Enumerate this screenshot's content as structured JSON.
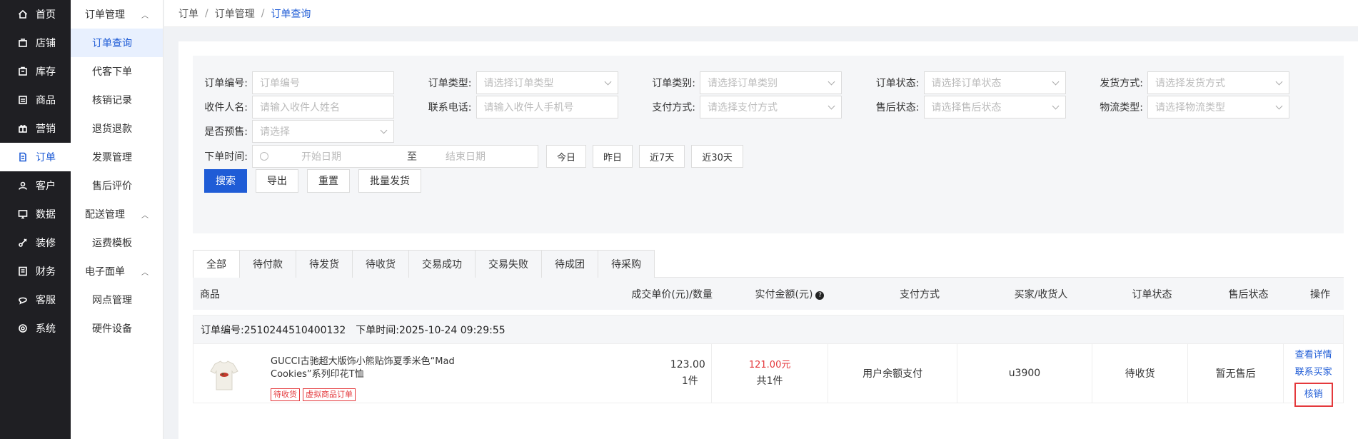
{
  "nav": {
    "items": [
      {
        "label": "首页",
        "icon": "home-icon"
      },
      {
        "label": "店铺",
        "icon": "shop-icon"
      },
      {
        "label": "库存",
        "icon": "inventory-icon"
      },
      {
        "label": "商品",
        "icon": "goods-icon"
      },
      {
        "label": "营销",
        "icon": "gift-icon"
      },
      {
        "label": "订单",
        "icon": "order-icon",
        "active": true
      },
      {
        "label": "客户",
        "icon": "user-icon"
      },
      {
        "label": "数据",
        "icon": "data-icon"
      },
      {
        "label": "装修",
        "icon": "brush-icon"
      },
      {
        "label": "财务",
        "icon": "finance-icon"
      },
      {
        "label": "客服",
        "icon": "chat-icon"
      },
      {
        "label": "系统",
        "icon": "gear-icon"
      }
    ]
  },
  "subnav": {
    "group1": "订单管理",
    "group1_items": [
      "订单查询",
      "代客下单",
      "核销记录",
      "退货退款",
      "发票管理",
      "售后评价"
    ],
    "group2": "配送管理",
    "group2_items": [
      "运费模板"
    ],
    "group3": "电子面单",
    "group3_items": [
      "网点管理",
      "硬件设备"
    ]
  },
  "breadcrumb": {
    "a": "订单",
    "b": "订单管理",
    "c": "订单查询",
    "sep": "/"
  },
  "filters": {
    "order_no": {
      "label": "订单编号:",
      "placeholder": "订单编号"
    },
    "order_type": {
      "label": "订单类型:",
      "placeholder": "请选择订单类型"
    },
    "order_category": {
      "label": "订单类别:",
      "placeholder": "请选择订单类别"
    },
    "order_status": {
      "label": "订单状态:",
      "placeholder": "请选择订单状态"
    },
    "ship_method": {
      "label": "发货方式:",
      "placeholder": "请选择发货方式"
    },
    "receiver": {
      "label": "收件人名:",
      "placeholder": "请输入收件人姓名"
    },
    "phone": {
      "label": "联系电话:",
      "placeholder": "请输入收件人手机号"
    },
    "pay_method": {
      "label": "支付方式:",
      "placeholder": "请选择支付方式"
    },
    "aftersale_status": {
      "label": "售后状态:",
      "placeholder": "请选择售后状态"
    },
    "logistics_type": {
      "label": "物流类型:",
      "placeholder": "请选择物流类型"
    },
    "presale": {
      "label": "是否预售:",
      "placeholder": "请选择"
    },
    "order_time": {
      "label": "下单时间:",
      "start": "开始日期",
      "to": "至",
      "end": "结束日期"
    },
    "quick": [
      "今日",
      "昨日",
      "近7天",
      "近30天"
    ],
    "actions": {
      "search": "搜索",
      "export": "导出",
      "reset": "重置",
      "batch_ship": "批量发货"
    }
  },
  "tabs": [
    "全部",
    "待付款",
    "待发货",
    "待收货",
    "交易成功",
    "交易失败",
    "待成团",
    "待采购"
  ],
  "table_header": {
    "goods": "商品",
    "unit_price_qty": "成交单价(元)/数量",
    "paid": "实付金额(元)",
    "pay_method": "支付方式",
    "buyer": "买家/收货人",
    "order_status": "订单状态",
    "aftersale": "售后状态",
    "ops": "操作"
  },
  "order": {
    "no_label": "订单编号:2510244510400132",
    "time_label": "下单时间:2025-10-24 09:29:55",
    "goods_name": "GUCCI古驰超大版饰小熊贴饰夏季米色“Mad Cookies”系列印花T恤",
    "tags": [
      "待收货",
      "虚拟商品订单"
    ],
    "unit_price": "123.00",
    "qty": "1件",
    "paid": "121.00元",
    "paid_count": "共1件",
    "pay_method": "用户余额支付",
    "buyer": "u3900",
    "status": "待收货",
    "aftersale": "暂无售后",
    "ops": {
      "detail": "查看详情",
      "contact": "联系买家",
      "verify": "核销"
    }
  },
  "colors": {
    "accent": "#1f5cd6",
    "danger": "#e4393c",
    "nav_bg": "#1f1f23"
  }
}
